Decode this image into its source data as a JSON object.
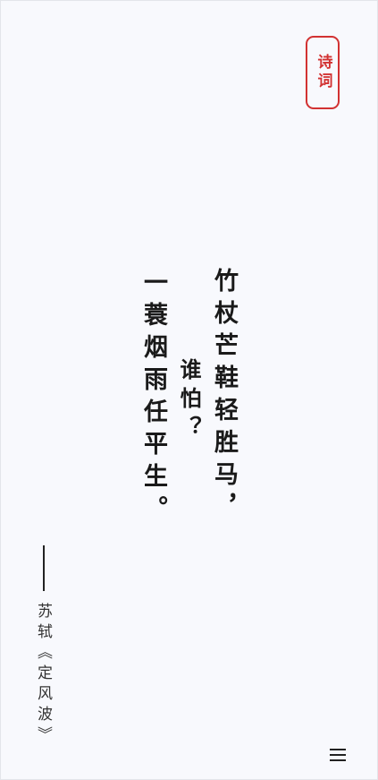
{
  "header": {
    "badge_label": "诗词"
  },
  "poem": {
    "lines": [
      "竹杖芒鞋轻胜马，",
      "谁怕？",
      "一蓑烟雨任平生。"
    ],
    "attribution": "苏轼《定风波》"
  },
  "nav": {
    "menu_icon": "hamburger-menu-icon"
  },
  "colors": {
    "accent": "#d23232",
    "text": "#1a1a1a",
    "background": "#f8f9fd"
  }
}
